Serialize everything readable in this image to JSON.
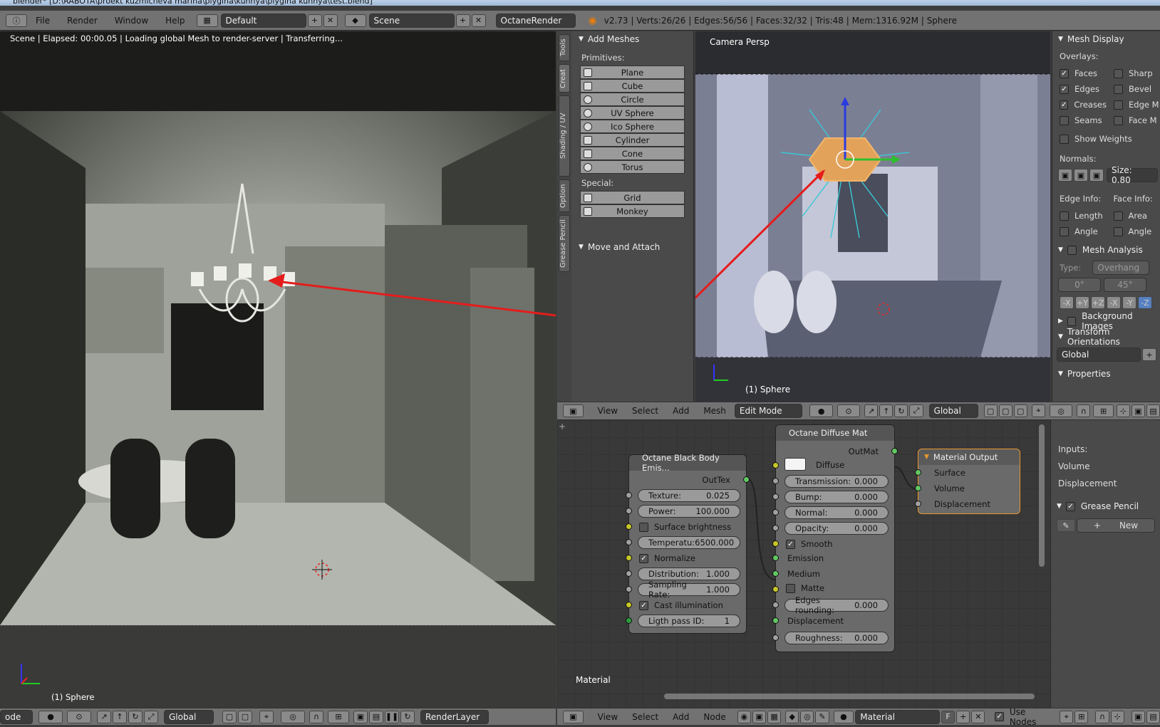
{
  "titlebar": {
    "text": "blender* [D:\\RABOTA\\proekt kuzmicheva marina\\plygina\\kuhnya\\plygina kuhnya\\test.blend]"
  },
  "topbar": {
    "menus": [
      "File",
      "Render",
      "Window",
      "Help"
    ],
    "layout": "Default",
    "scene": "Scene",
    "engine": "OctaneRender",
    "stats": "v2.73 | Verts:26/26 | Edges:56/56 | Faces:32/32 | Tris:48 | Mem:1316.92M | Sphere"
  },
  "render": {
    "status": "Scene | Elapsed: 00:00.05 | Loading global Mesh to render-server | Transferring...",
    "object_name": "(1) Sphere"
  },
  "bottom_left_header": {
    "mode": "ode",
    "orientation": "Global",
    "layer": "RenderLayer"
  },
  "tool_tabs": [
    "Tools",
    "Creat",
    "Shading / UV",
    "Option",
    "Grease Pencil"
  ],
  "shelf": {
    "add_meshes_title": "Add Meshes",
    "primitives_label": "Primitives:",
    "primitives": [
      "Plane",
      "Cube",
      "Circle",
      "UV Sphere",
      "Ico Sphere",
      "Cylinder",
      "Cone",
      "Torus"
    ],
    "special_label": "Special:",
    "special": [
      "Grid",
      "Monkey"
    ],
    "move_attach_title": "Move and Attach"
  },
  "viewport": {
    "title": "Camera Persp",
    "object_name": "(1) Sphere"
  },
  "props": {
    "mesh_display": "Mesh Display",
    "overlays_label": "Overlays:",
    "overlays_left": [
      {
        "label": "Faces",
        "checked": true
      },
      {
        "label": "Edges",
        "checked": true
      },
      {
        "label": "Creases",
        "checked": true
      },
      {
        "label": "Seams",
        "checked": false
      }
    ],
    "overlays_right": [
      {
        "label": "Sharp",
        "checked": false
      },
      {
        "label": "Bevel",
        "checked": false
      },
      {
        "label": "Edge M",
        "checked": false
      },
      {
        "label": "Face M",
        "checked": false
      }
    ],
    "show_weights": "Show Weights",
    "normals_label": "Normals:",
    "normals_size": "Size: 0.80",
    "edge_info": "Edge Info:",
    "face_info": "Face Info:",
    "edge_items": [
      "Length",
      "Angle"
    ],
    "face_items": [
      "Area",
      "Angle"
    ],
    "mesh_analysis": "Mesh Analysis",
    "type_label": "Type:",
    "type_value": "Overhang",
    "angle_min": "0°",
    "angle_max": "45°",
    "axes": [
      "-X",
      "+Y",
      "+Z",
      "-X",
      "-Y",
      "-Z"
    ],
    "background_images": "Background Images",
    "transform_orientations": "Transform Orientations",
    "orientation_value": "Global",
    "properties": "Properties"
  },
  "vp_header": {
    "menus": [
      "View",
      "Select",
      "Add",
      "Mesh"
    ],
    "mode": "Edit Mode",
    "orientation": "Global"
  },
  "nodes": {
    "black_body": {
      "title": "Octane Black Body Emis...",
      "out": "OutTex",
      "texture": {
        "label": "Texture:",
        "value": "0.025"
      },
      "power": {
        "label": "Power:",
        "value": "100.000"
      },
      "surface_brightness": "Surface brightness",
      "temperature": {
        "label": "Temperatu:",
        "value": "6500.000"
      },
      "normalize": "Normalize",
      "distribution": {
        "label": "Distribution:",
        "value": "1.000"
      },
      "sampling": {
        "label": "Sampling Rate:",
        "value": "1.000"
      },
      "cast": "Cast illumination",
      "pass_id": {
        "label": "Ligth pass ID:",
        "value": "1"
      }
    },
    "diffuse": {
      "title": "Octane Diffuse Mat",
      "out": "OutMat",
      "diffuse": "Diffuse",
      "transmission": {
        "label": "Transmission:",
        "value": "0.000"
      },
      "bump": {
        "label": "Bump:",
        "value": "0.000"
      },
      "normal": {
        "label": "Normal:",
        "value": "0.000"
      },
      "opacity": {
        "label": "Opacity:",
        "value": "0.000"
      },
      "smooth": "Smooth",
      "emission": "Emission",
      "medium": "Medium",
      "matte": "Matte",
      "edges": {
        "label": "Edges rounding:",
        "value": "0.000"
      },
      "displacement": "Displacement",
      "roughness": {
        "label": "Roughness:",
        "value": "0.000"
      }
    },
    "output": {
      "title": "Material Output",
      "surface": "Surface",
      "volume": "Volume",
      "displacement": "Displacement"
    },
    "material_label": "Material"
  },
  "node_side": {
    "inputs": "Inputs:",
    "volume": "Volume",
    "displacement": "Displacement",
    "grease_pencil": "Grease Pencil",
    "new": "New"
  },
  "br_header": {
    "menus": [
      "View",
      "Select",
      "Add",
      "Node"
    ],
    "material": "Material",
    "f": "F",
    "use_nodes": "Use Nodes"
  }
}
